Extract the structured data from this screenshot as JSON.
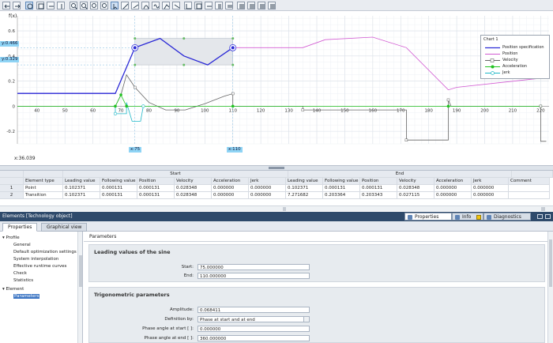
{
  "chart": {
    "y_unit": "f(x)",
    "x_readout": "x:36.039",
    "marker_labels": {
      "y_high": "y:0.466",
      "y_low": "y:0.329",
      "x_start": "x:75",
      "x_end": "x:110"
    },
    "legend": {
      "title": "Chart 1",
      "items": [
        {
          "label": "Position specification",
          "color": "#2a2ad6"
        },
        {
          "label": "Position",
          "color": "#d25ad2"
        },
        {
          "label": "Velocity",
          "color": "#666666"
        },
        {
          "label": "Acceleration",
          "color": "#22c322"
        },
        {
          "label": "Jerk",
          "color": "#1fb8c8"
        }
      ]
    },
    "x_ticks": [
      "40",
      "50",
      "60",
      "70",
      "80",
      "90",
      "100",
      "110",
      "120",
      "130",
      "140",
      "150",
      "160",
      "170",
      "180",
      "190",
      "200",
      "210",
      "220"
    ],
    "y_ticks": [
      "0.6",
      "0.4",
      "0.2",
      "0",
      "-0.2"
    ]
  },
  "chart_data": {
    "type": "line",
    "xlim": [
      33,
      223
    ],
    "ylim": [
      -0.3,
      0.72
    ],
    "series": [
      {
        "name": "Position specification",
        "color": "#2a2ad6",
        "points": [
          [
            33,
            0.102
          ],
          [
            68,
            0.102
          ],
          [
            75,
            0.466
          ],
          [
            84,
            0.54
          ],
          [
            92.5,
            0.4
          ],
          [
            101,
            0.329
          ],
          [
            110,
            0.466
          ]
        ]
      },
      {
        "name": "Position",
        "color": "#d25ad2",
        "points": [
          [
            33,
            0.102
          ],
          [
            68,
            0.102
          ],
          [
            75,
            0.466
          ],
          [
            84,
            0.54
          ],
          [
            92.5,
            0.4
          ],
          [
            101,
            0.329
          ],
          [
            110,
            0.466
          ],
          [
            135,
            0.466
          ],
          [
            143,
            0.53
          ],
          [
            160,
            0.55
          ],
          [
            172,
            0.466
          ],
          [
            187,
            0.13
          ],
          [
            190,
            0.15
          ],
          [
            223,
            0.23
          ]
        ]
      },
      {
        "name": "Velocity",
        "color": "#666666",
        "points": [
          [
            33,
            0
          ],
          [
            68,
            0
          ],
          [
            70,
            0.09
          ],
          [
            72,
            0.25
          ],
          [
            75,
            0.15
          ],
          [
            80,
            0.03
          ],
          [
            86,
            -0.03
          ],
          [
            93,
            -0.03
          ],
          [
            100,
            0.02
          ],
          [
            107,
            0.08
          ],
          [
            110,
            0.1
          ],
          [
            110,
            0
          ],
          [
            135,
            0
          ],
          [
            135,
            -0.03
          ],
          [
            172,
            -0.03
          ],
          [
            172,
            -0.27
          ],
          [
            187,
            -0.27
          ],
          [
            187,
            0.05
          ],
          [
            188,
            0
          ],
          [
            220,
            0
          ],
          [
            220,
            -0.28
          ],
          [
            222,
            -0.28
          ]
        ]
      },
      {
        "name": "Acceleration",
        "color": "#22c322",
        "points": [
          [
            33,
            0
          ],
          [
            68,
            0
          ],
          [
            70,
            0.09
          ],
          [
            72,
            0
          ],
          [
            110,
            0
          ],
          [
            187,
            0
          ],
          [
            220,
            0
          ]
        ]
      },
      {
        "name": "Jerk",
        "color": "#1fb8c8",
        "points": [
          [
            68,
            0
          ],
          [
            68,
            -0.06
          ],
          [
            72,
            -0.06
          ],
          [
            72,
            0.03
          ],
          [
            74,
            -0.12
          ],
          [
            77,
            -0.12
          ],
          [
            78,
            0
          ]
        ]
      }
    ]
  },
  "table": {
    "group_start": "Start",
    "group_end": "End",
    "headers": [
      "Element type",
      "Leading value",
      "Following value",
      "Position",
      "Velocity",
      "Acceleration",
      "Jerk",
      "Leading value",
      "Following value",
      "Position",
      "Velocity",
      "Acceleration",
      "Jerk",
      "Comment"
    ],
    "rows": [
      {
        "num": "1",
        "cells": [
          "Point",
          "0.102371",
          "0.000131",
          "0.000131",
          "0.028348",
          "0.000000",
          "0.000000",
          "0.102371",
          "0.000131",
          "0.000131",
          "0.028348",
          "0.000000",
          "0.000000",
          ""
        ]
      },
      {
        "num": "2",
        "cells": [
          "Transition",
          "0.102371",
          "0.000131",
          "0.000131",
          "0.028348",
          "0.000000",
          "0.000000",
          "7.271682",
          "0.203364",
          "0.203343",
          "0.027115",
          "0.000000",
          "0.000000",
          ""
        ]
      }
    ]
  },
  "panel": {
    "title": "Elements [Technology object]",
    "tabs": [
      "Properties",
      "Info",
      "Diagnostics"
    ]
  },
  "subtabs": [
    "Properties",
    "Graphical view"
  ],
  "nav": {
    "profile": "Profile",
    "profile_items": [
      "General",
      "Default optimization settings",
      "System interpolation",
      "Effective runtime curves",
      "Check",
      "Statistics"
    ],
    "element": "Element",
    "element_items": [
      "Parameters"
    ]
  },
  "content": {
    "section": "Parameters",
    "sine_group": {
      "title": "Leading values of the sine",
      "start_label": "Start:",
      "start_value": "75.000000",
      "end_label": "End:",
      "end_value": "110.000000"
    },
    "trig_group": {
      "title": "Trigonometric parameters",
      "amp_label": "Amplitude:",
      "amp_value": "0.068411",
      "def_label": "Definition by:",
      "def_value": "Phase at start and at end",
      "pstart_label": "Phase angle at start [ ]:",
      "pstart_value": "0.000000",
      "pend_label": "Phase angle at end [ ]:",
      "pend_value": "360.000000"
    }
  }
}
